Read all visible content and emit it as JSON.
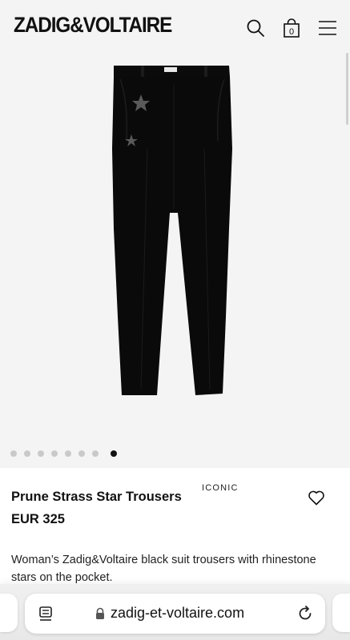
{
  "header": {
    "logo_text": "ZADIG&VOLTAIRE",
    "icons": [
      "search-icon",
      "bag-icon",
      "menu-icon"
    ],
    "cart_count": "0"
  },
  "gallery": {
    "image_alt": "Black suit trousers with rhinestone stars",
    "slide_count": 8,
    "active_slide": 8
  },
  "product": {
    "title": "Prune Strass Star Trousers",
    "badge": "ICONIC",
    "price": "EUR 325",
    "description": "Woman’s Zadig&Voltaire black suit trousers with rhinestone stars on the pocket."
  },
  "browser": {
    "url": "zadig-et-voltaire.com",
    "icons": [
      "tabs-icon",
      "lock-icon",
      "reload-icon"
    ]
  },
  "colors": {
    "background": "#f4f4f4",
    "text": "#111111",
    "active_dot": "#111111",
    "inactive_dot": "#c9c9c9"
  }
}
